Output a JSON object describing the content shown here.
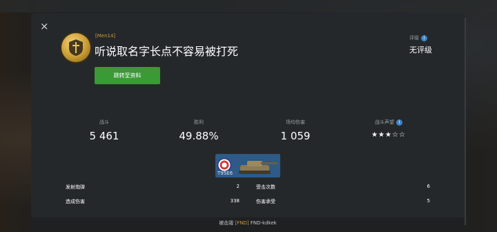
{
  "header": {
    "close_icon": "×",
    "clan_tag": "[Men14]",
    "player_name": "听说取名字长点不容易被打死",
    "profile_button_label": "跳转至资料",
    "rating_label": "评级",
    "rating_value": "无评级"
  },
  "stats": [
    {
      "label": "战斗",
      "value": "5 461"
    },
    {
      "label": "胜利",
      "value": "49.88%"
    },
    {
      "label": "场均伤害",
      "value": "1 059"
    },
    {
      "label": "战斗声望",
      "value": "★★★☆☆"
    }
  ],
  "tank": {
    "name": "T95E6"
  },
  "battle_stats": [
    {
      "label": "发射炮弹",
      "value": "2"
    },
    {
      "label": "受击次数",
      "value": "6"
    },
    {
      "label": "造成伤害",
      "value": "338"
    },
    {
      "label": "伤害承受",
      "value": "5"
    }
  ],
  "footer": {
    "prefix": "被击毁",
    "clan": "[FND]",
    "player": "FND-kdkek"
  },
  "colors": {
    "accent_green": "#3a9a35",
    "clan_gold": "#c89a3b",
    "info_blue": "#3d86c8",
    "panel_bg": "#25282b"
  }
}
